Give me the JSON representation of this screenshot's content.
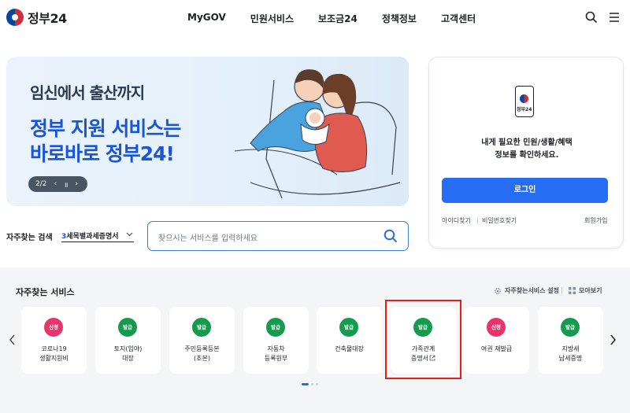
{
  "header": {
    "logo_text": "정부24",
    "nav": [
      "MyGOV",
      "민원서비스",
      "보조금24",
      "정책정보",
      "고객센터"
    ]
  },
  "banner": {
    "line1": "임신에서 출산까지",
    "line2": "정부 지원 서비스는",
    "line3": "바로바로 정부24!",
    "pager": "2/2",
    "pager_prev": "‹",
    "pager_pause": "॥",
    "pager_next": "›"
  },
  "frequent_search": {
    "label": "자주찾는 검색",
    "selected_num": "3",
    "selected_text": "세목별과세증명서"
  },
  "search": {
    "placeholder": "찾으시는 서비스를 입력하세요"
  },
  "login": {
    "phone_label": "정부24",
    "message_line1": "내게 필요한 민원/생활/혜택",
    "message_line2": "정보를 확인하세요.",
    "button": "로그인",
    "find_id": "아이디찾기",
    "find_pw": "비밀번호찾기",
    "signup": "회원가입"
  },
  "services": {
    "title": "자주찾는 서비스",
    "settings_label": "자주찾는서비스 설정",
    "view_all_label": "모아보기",
    "items": [
      {
        "badge": "신청",
        "badge_type": "new",
        "line1": "코로나19",
        "line2": "생활지원비"
      },
      {
        "badge": "발급",
        "badge_type": "issue",
        "line1": "토지(임야)",
        "line2": "대장"
      },
      {
        "badge": "발급",
        "badge_type": "issue",
        "line1": "주민등록등본",
        "line2": "(초본)"
      },
      {
        "badge": "발급",
        "badge_type": "issue",
        "line1": "자동차",
        "line2": "등록원부"
      },
      {
        "badge": "발급",
        "badge_type": "issue",
        "line1": "건축물대장",
        "line2": ""
      },
      {
        "badge": "발급",
        "badge_type": "issue",
        "line1": "가족관계",
        "line2": "증명서"
      },
      {
        "badge": "신청",
        "badge_type": "new",
        "line1": "여권 재발급",
        "line2": ""
      },
      {
        "badge": "발급",
        "badge_type": "issue",
        "line1": "지방세",
        "line2": "납세증명"
      }
    ]
  },
  "colors": {
    "primary": "#256ef4",
    "badge_new": "#e8336d",
    "badge_issue": "#149b4e",
    "highlight": "#e0201b"
  }
}
